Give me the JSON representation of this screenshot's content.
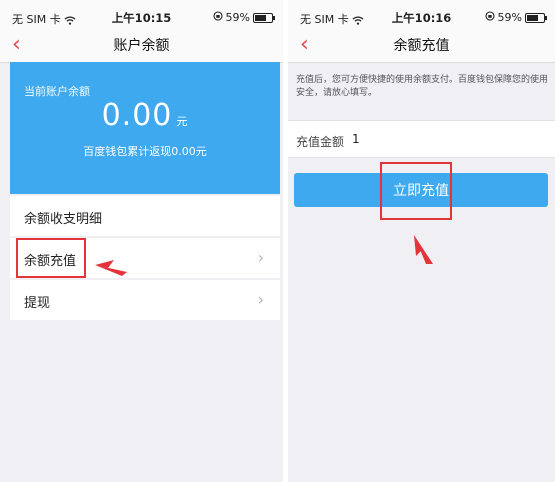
{
  "left": {
    "status": {
      "carrier": "无 SIM 卡",
      "time": "上午10:15",
      "battery": "59%"
    },
    "nav": {
      "back": "‹",
      "title": "账户余额"
    },
    "balance": {
      "label": "当前账户余额",
      "amount": "0.00",
      "unit": "元",
      "rebate": "百度钱包累计返现0.00元"
    },
    "list": {
      "detail": "余额收支明细",
      "recharge": "余额充值",
      "withdraw": "提现",
      "chevron": "›"
    }
  },
  "right": {
    "status": {
      "carrier": "无 SIM 卡",
      "time": "上午10:16",
      "battery": "59%"
    },
    "nav": {
      "back": "‹",
      "title": "余额充值"
    },
    "notice": "充值后，您可方便快捷的使用余额支付。百度钱包保障您的使用安全，请放心填写。",
    "amount_label": "充值金额",
    "amount_value": "1",
    "recharge_button": "立即充值"
  },
  "colors": {
    "accent": "#3ea9ee",
    "highlight": "#e3343a",
    "back": "#e5484d"
  }
}
